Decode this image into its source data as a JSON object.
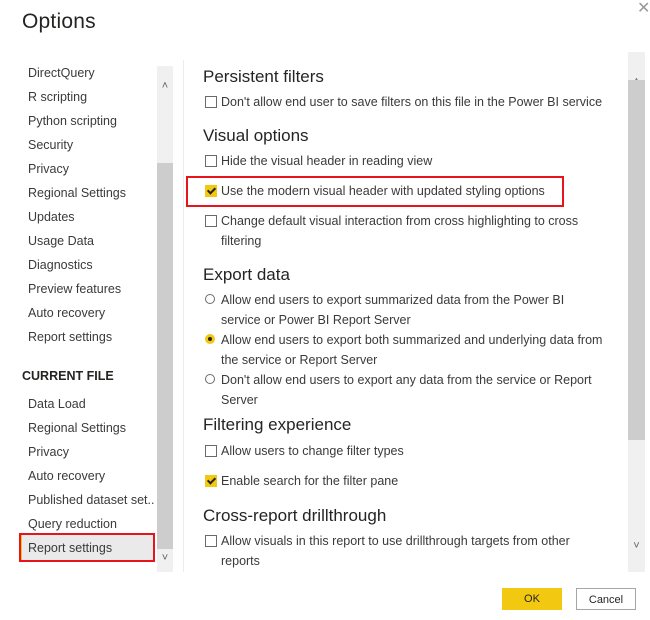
{
  "dialog": {
    "title": "Options",
    "close_icon": "close-icon"
  },
  "nav": {
    "global_items": [
      {
        "label": "DirectQuery"
      },
      {
        "label": "R scripting"
      },
      {
        "label": "Python scripting"
      },
      {
        "label": "Security"
      },
      {
        "label": "Privacy"
      },
      {
        "label": "Regional Settings"
      },
      {
        "label": "Updates"
      },
      {
        "label": "Usage Data"
      },
      {
        "label": "Diagnostics"
      },
      {
        "label": "Preview features"
      },
      {
        "label": "Auto recovery"
      },
      {
        "label": "Report settings"
      }
    ],
    "current_file_heading": "CURRENT FILE",
    "current_file_items": [
      {
        "label": "Data Load"
      },
      {
        "label": "Regional Settings"
      },
      {
        "label": "Privacy"
      },
      {
        "label": "Auto recovery"
      },
      {
        "label": "Published dataset set..."
      },
      {
        "label": "Query reduction"
      },
      {
        "label": "Report settings",
        "selected": true
      }
    ],
    "scroll_up_icon": "chevron-up-icon",
    "scroll_down_icon": "chevron-down-icon"
  },
  "content": {
    "sections": {
      "persistent_filters": {
        "title": "Persistent filters",
        "options": [
          {
            "label": "Don't allow end user to save filters on this file in the Power BI service",
            "checked": false
          }
        ]
      },
      "visual_options": {
        "title": "Visual options",
        "options": [
          {
            "label": "Hide the visual header in reading view",
            "checked": false
          },
          {
            "label": "Use the modern visual header with updated styling options",
            "checked": true,
            "highlighted": true
          },
          {
            "label": "Change default visual interaction from cross highlighting to cross filtering",
            "checked": false
          }
        ]
      },
      "export_data": {
        "title": "Export data",
        "options": [
          {
            "label": "Allow end users to export summarized data from the Power BI service or Power BI Report Server",
            "selected": false
          },
          {
            "label": "Allow end users to export both summarized and underlying data from the service or Report Server",
            "selected": true
          },
          {
            "label": "Don't allow end users to export any data from the service or Report Server",
            "selected": false
          }
        ]
      },
      "filtering_experience": {
        "title": "Filtering experience",
        "options": [
          {
            "label": "Allow users to change filter types",
            "checked": false
          },
          {
            "label": "Enable search for the filter pane",
            "checked": true
          }
        ]
      },
      "cross_report": {
        "title": "Cross-report drillthrough",
        "options": [
          {
            "label": "Allow visuals in this report to use drillthrough targets from other reports",
            "checked": false
          }
        ]
      }
    }
  },
  "footer": {
    "ok_label": "OK",
    "cancel_label": "Cancel"
  },
  "colors": {
    "accent": "#f2c811",
    "highlight_border": "#e8141c"
  }
}
